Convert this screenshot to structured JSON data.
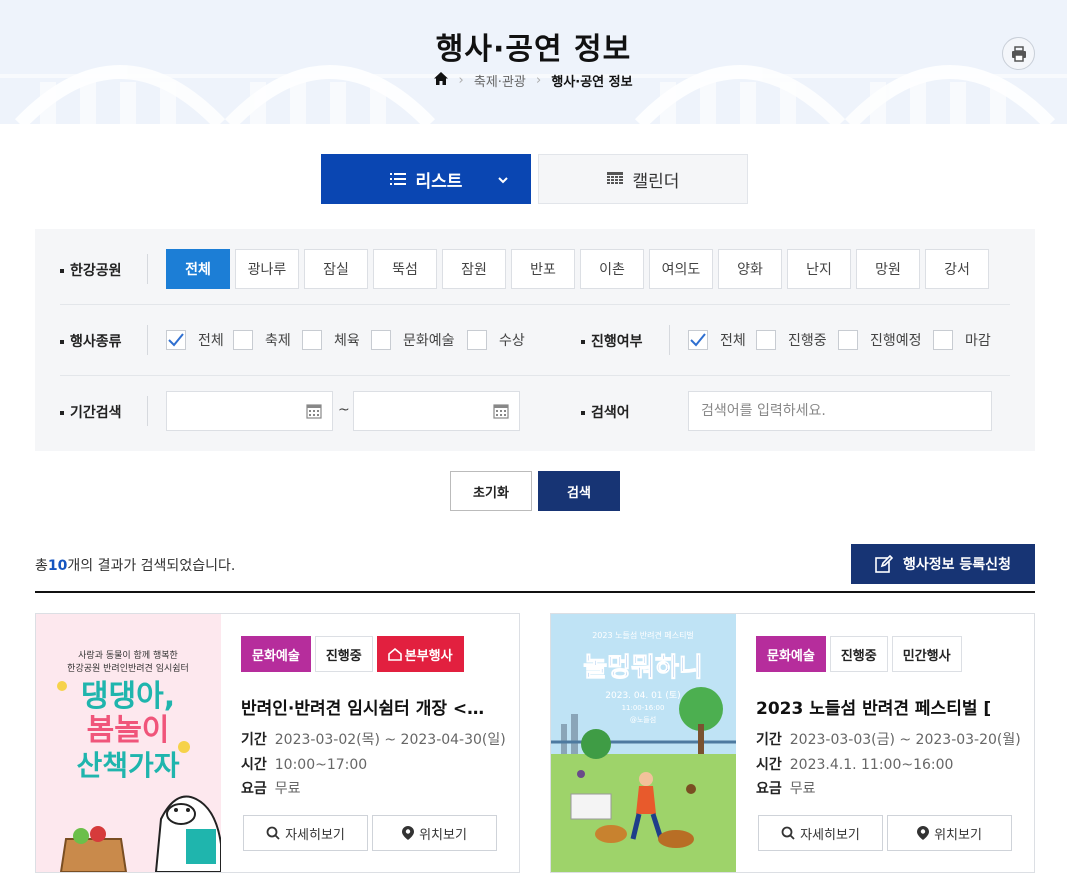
{
  "page": {
    "title": "행사·공연 정보",
    "breadcrumb": [
      "축제·관광",
      "행사·공연 정보"
    ]
  },
  "view": {
    "list_label": "리스트",
    "calendar_label": "캘린더"
  },
  "filters": {
    "park_label": "한강공원",
    "parks": [
      "전체",
      "광나루",
      "잠실",
      "뚝섬",
      "잠원",
      "반포",
      "이촌",
      "여의도",
      "양화",
      "난지",
      "망원",
      "강서"
    ],
    "type_label": "행사종류",
    "types": [
      {
        "label": "전체",
        "checked": true
      },
      {
        "label": "축제",
        "checked": false
      },
      {
        "label": "체육",
        "checked": false
      },
      {
        "label": "문화예술",
        "checked": false
      },
      {
        "label": "수상",
        "checked": false
      }
    ],
    "status_label": "진행여부",
    "statuses": [
      {
        "label": "전체",
        "checked": true
      },
      {
        "label": "진행중",
        "checked": false
      },
      {
        "label": "진행예정",
        "checked": false
      },
      {
        "label": "마감",
        "checked": false
      }
    ],
    "period_label": "기간검색",
    "period_separator": "~",
    "keyword_label": "검색어",
    "keyword_placeholder": "검색어를 입력하세요."
  },
  "actions": {
    "reset": "초기화",
    "search": "검색",
    "register": "행사정보 등록신청"
  },
  "result": {
    "prefix": "총",
    "count": "10",
    "suffix": "개의 결과가 검색되었습니다."
  },
  "cards": [
    {
      "tags": [
        "문화예술",
        "진행중",
        "본부행사"
      ],
      "title": "반려인·반려견 임시쉼터 개장 <…",
      "period_label": "기간",
      "period": "2023-03-02(목) ~ 2023-04-30(일)",
      "time_label": "시간",
      "time": "10:00~17:00",
      "fee_label": "요금",
      "fee": "무료",
      "detail": "자세히보기",
      "map": "위치보기",
      "poster": {
        "top1": "사랑과 동물이 함께 행복한",
        "top2": "한강공원 반려인반려견 임시쉼터",
        "line1": "댕댕아,",
        "line2": "봄놀이",
        "line3": "산책가자"
      }
    },
    {
      "tags": [
        "문화예술",
        "진행중",
        "민간행사"
      ],
      "title": "2023 노들섬 반려견 페스티벌 [",
      "period_label": "기간",
      "period": "2023-03-03(금) ~ 2023-03-20(월)",
      "time_label": "시간",
      "time": "2023.4.1. 11:00~16:00",
      "fee_label": "요금",
      "fee": "무료",
      "detail": "자세히보기",
      "map": "위치보기",
      "poster": {
        "top": "2023 노들섬 반려견 페스티벌",
        "headline": "놀멍뭐하니",
        "date": "2023. 04. 01 (토)",
        "hours": "11:00-16:00",
        "place": "@노들섬"
      }
    }
  ],
  "colors": {
    "primary": "#0a46b2",
    "navy": "#173474",
    "active_chip": "#1c7ed6",
    "category_tag": "#b62d9c",
    "hq_tag": "#e2203f"
  }
}
